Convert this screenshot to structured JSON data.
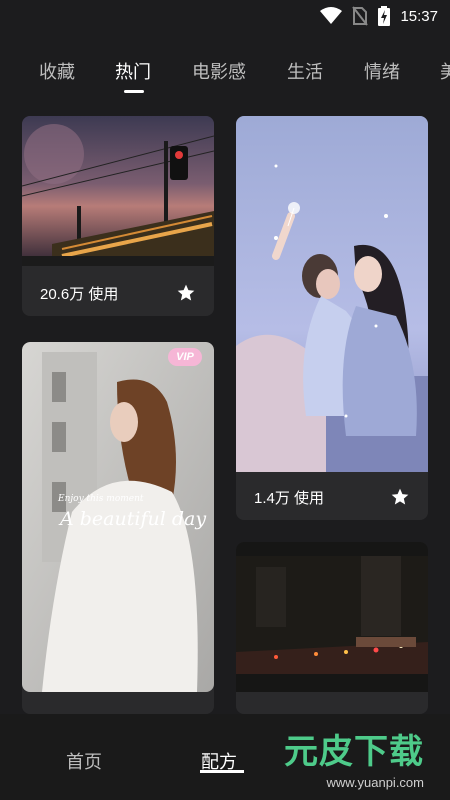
{
  "status_bar": {
    "time": "15:37",
    "icons": [
      "wifi-icon",
      "no-sim-icon",
      "battery-charging-icon"
    ]
  },
  "tabs": [
    {
      "label": "收藏"
    },
    {
      "label": "热门"
    },
    {
      "label": "电影感"
    },
    {
      "label": "生活"
    },
    {
      "label": "情绪"
    },
    {
      "label": "美"
    }
  ],
  "active_tab": "热门",
  "cards": [
    {
      "usage": "20.6万 使用",
      "vip": false
    },
    {
      "usage": "1.4万 使用",
      "vip": false
    },
    {
      "usage": "",
      "vip": true,
      "vip_label": "VIP",
      "overlay_text": "A beautiful day",
      "overlay_small": "Enjoy this moment"
    },
    {
      "usage": "",
      "vip": false
    }
  ],
  "bottom_nav": [
    {
      "label": "首页"
    },
    {
      "label": "配方"
    }
  ],
  "active_nav": "配方",
  "watermark": {
    "title": "元皮下载",
    "url": "www.yuanpi.com"
  },
  "colors": {
    "background": "#1c1c1e",
    "card": "#2a2a2c",
    "vip": "#f6b6d6",
    "watermark": "#4ecb8a"
  }
}
